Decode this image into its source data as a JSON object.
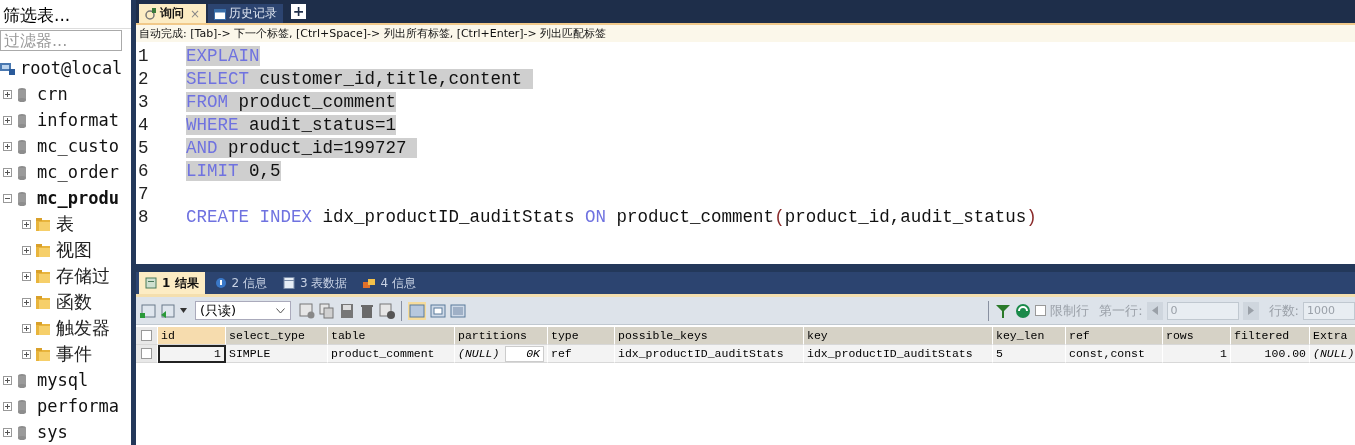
{
  "sidebar": {
    "title": "筛选表...",
    "filter": {
      "placeholder": "过滤器..."
    },
    "tree": [
      {
        "label": "root@local",
        "kind": "server",
        "children": [
          {
            "label": "crn",
            "kind": "database",
            "expanded": false,
            "bold": false
          },
          {
            "label": "informat",
            "kind": "database",
            "expanded": false,
            "bold": false
          },
          {
            "label": "mc_custo",
            "kind": "database",
            "expanded": false,
            "bold": false
          },
          {
            "label": "mc_order",
            "kind": "database",
            "expanded": false,
            "bold": false
          },
          {
            "label": "mc_produ",
            "kind": "database",
            "expanded": true,
            "bold": true,
            "children": [
              {
                "label": "表",
                "kind": "folder",
                "expanded": false
              },
              {
                "label": "视图",
                "kind": "folder",
                "expanded": false
              },
              {
                "label": "存储过",
                "kind": "folder",
                "expanded": false
              },
              {
                "label": "函数",
                "kind": "folder",
                "expanded": false
              },
              {
                "label": "触发器",
                "kind": "folder",
                "expanded": false
              },
              {
                "label": "事件",
                "kind": "folder",
                "expanded": false
              }
            ]
          },
          {
            "label": "mysql",
            "kind": "database",
            "expanded": false,
            "bold": false
          },
          {
            "label": "performa",
            "kind": "database",
            "expanded": false,
            "bold": false
          },
          {
            "label": "sys",
            "kind": "database",
            "expanded": false,
            "bold": false
          }
        ]
      }
    ]
  },
  "editor_tabs": [
    {
      "label": "询问",
      "selected": true,
      "close": "×"
    },
    {
      "label": "历史记录",
      "selected": false
    }
  ],
  "add_tab": "+",
  "hint": "自动完成: [Tab]-> 下一个标签, [Ctrl+Space]-> 列出所有标签, [Ctrl+Enter]-> 列出匹配标签",
  "code_lines": [
    {
      "number": "1",
      "selected": true,
      "tokens": [
        {
          "text": "EXPLAIN",
          "kind": "keyword"
        }
      ]
    },
    {
      "number": "2",
      "selected": true,
      "tokens": [
        {
          "text": "SELECT",
          "kind": "keyword"
        },
        {
          "text": " customer_id,title,content ",
          "kind": "ident"
        }
      ]
    },
    {
      "number": "3",
      "selected": true,
      "tokens": [
        {
          "text": "FROM",
          "kind": "keyword"
        },
        {
          "text": " product_comment",
          "kind": "ident"
        }
      ]
    },
    {
      "number": "4",
      "selected": true,
      "tokens": [
        {
          "text": "WHERE",
          "kind": "keyword"
        },
        {
          "text": " audit_status=1",
          "kind": "ident"
        }
      ]
    },
    {
      "number": "5",
      "selected": true,
      "tokens": [
        {
          "text": "AND",
          "kind": "keyword"
        },
        {
          "text": " product_id=199727 ",
          "kind": "ident"
        }
      ]
    },
    {
      "number": "6",
      "selected": true,
      "tokens": [
        {
          "text": "LIMIT",
          "kind": "keyword"
        },
        {
          "text": " 0,5",
          "kind": "ident"
        }
      ]
    },
    {
      "number": "7"
    },
    {
      "number": "8",
      "selected": false,
      "tokens": [
        {
          "text": "CREATE INDEX",
          "kind": "keyword"
        },
        {
          "text": " idx_productID_auditStats ",
          "kind": "ident"
        },
        {
          "text": "ON",
          "kind": "keyword"
        },
        {
          "text": " product_comment",
          "kind": "ident"
        },
        {
          "text": "(",
          "kind": "punct"
        },
        {
          "text": "product_id,audit_status",
          "kind": "ident"
        },
        {
          "text": ")",
          "kind": "punct"
        }
      ]
    }
  ],
  "result_tabs": [
    {
      "label": "1 结果",
      "selected": true
    },
    {
      "label": "2 信息",
      "selected": false
    },
    {
      "label": "3 表数据",
      "selected": false
    },
    {
      "label": "4 信息",
      "selected": false
    }
  ],
  "toolbar": {
    "mode": "(只读)",
    "limit": {
      "label": "限制行",
      "checked": false,
      "disabled": true
    },
    "first_row_label": "第一行:",
    "first_row": "0",
    "rows_label": "行数:",
    "rows": "1000"
  },
  "table": {
    "all_checked": false,
    "columns": [
      "id",
      "select_type",
      "table",
      "partitions",
      "type",
      "possible_keys",
      "key",
      "key_len",
      "ref",
      "rows",
      "filtered",
      "Extra"
    ],
    "rows": [
      {
        "checked": false,
        "cells": [
          {
            "text": "1",
            "kind": "number"
          },
          {
            "text": "SIMPLE",
            "kind": "text"
          },
          {
            "text": "product_comment",
            "kind": "text"
          },
          {
            "text": "(NULL)",
            "kind": "null",
            "overlay": "0K"
          },
          {
            "text": "ref",
            "kind": "text"
          },
          {
            "text": "idx_productID_auditStats",
            "kind": "text"
          },
          {
            "text": "idx_productID_auditStats",
            "kind": "text"
          },
          {
            "text": "5",
            "kind": "text"
          },
          {
            "text": "const,const",
            "kind": "text"
          },
          {
            "text": "1",
            "kind": "number"
          },
          {
            "text": "100.00",
            "kind": "number"
          },
          {
            "text": "(NULL)",
            "kind": "null"
          }
        ]
      }
    ]
  }
}
